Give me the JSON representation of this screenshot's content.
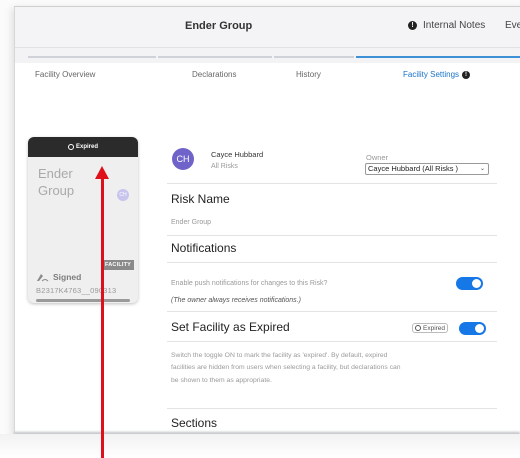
{
  "header": {
    "title": "Ender Group",
    "internal_notes": "Internal Notes",
    "events_cut": "Eve"
  },
  "tabs": [
    {
      "label": "Facility Overview"
    },
    {
      "label": "Declarations"
    },
    {
      "label": "History"
    },
    {
      "label": "Facility Settings"
    }
  ],
  "card": {
    "status": "Expired",
    "name": "Ender Group",
    "avatar": "CH",
    "badge": "FACILITY",
    "signed": "Signed",
    "code": "B2317K4763__090313"
  },
  "owner": {
    "avatar": "CH",
    "name": "Cayce Hubbard",
    "sub": "All Risks",
    "label": "Owner",
    "selected": "Cayce Hubbard (All Risks )"
  },
  "risk_name": {
    "title": "Risk Name",
    "value": "Ender Group"
  },
  "notifications": {
    "title": "Notifications",
    "toggle_label": "Enable push notifications for changes to this Risk?",
    "note": "(The owner always receives notifications.)",
    "enabled": true
  },
  "expired": {
    "title": "Set Facility as Expired",
    "pill": "Expired",
    "description": "Switch the toggle ON to mark the facility as 'expired'. By default, expired facilities are hidden from users when selecting a facility, but declarations can be shown to them as appropriate.",
    "enabled": true
  },
  "sections": {
    "title": "Sections"
  },
  "colors": {
    "accent": "#1678e6",
    "annotation": "#e0101a",
    "owner_avatar": "#6f63c9"
  }
}
